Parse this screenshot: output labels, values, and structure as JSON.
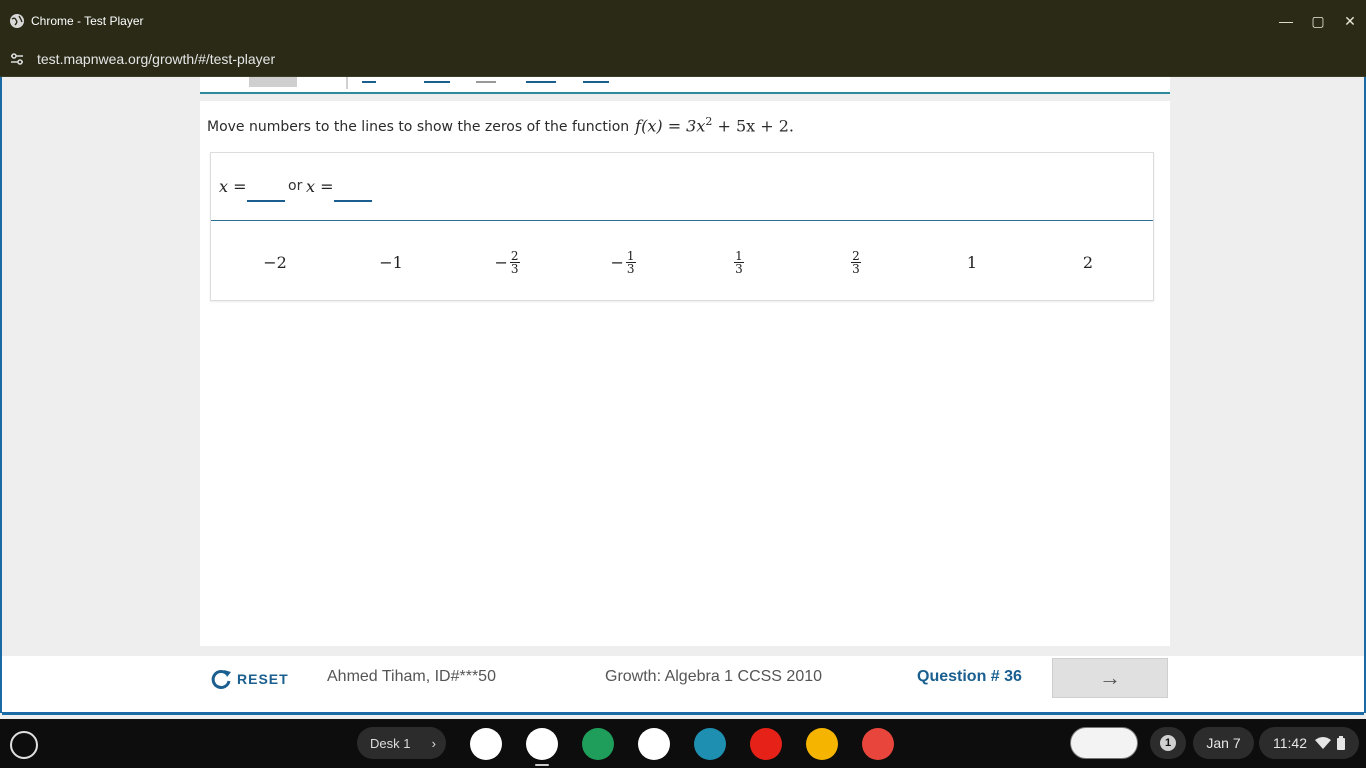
{
  "window": {
    "title": "Chrome - Test Player",
    "url": "test.mapnwea.org/growth/#/test-player"
  },
  "question": {
    "prompt": "Move numbers to the lines to show the zeros of the function",
    "function_lhs": "f(x) = 3x",
    "exponent": "2",
    "function_rhs": " + 5x + 2.",
    "answer_label_1": "x =",
    "or_text": "or",
    "answer_label_2": "x ="
  },
  "tiles": [
    {
      "sign": "",
      "whole": "−2",
      "num": "",
      "den": ""
    },
    {
      "sign": "",
      "whole": "−1",
      "num": "",
      "den": ""
    },
    {
      "sign": "−",
      "whole": "",
      "num": "2",
      "den": "3"
    },
    {
      "sign": "−",
      "whole": "",
      "num": "1",
      "den": "3"
    },
    {
      "sign": "",
      "whole": "",
      "num": "1",
      "den": "3"
    },
    {
      "sign": "",
      "whole": "",
      "num": "2",
      "den": "3"
    },
    {
      "sign": "",
      "whole": "1",
      "num": "",
      "den": ""
    },
    {
      "sign": "",
      "whole": "2",
      "num": "",
      "den": ""
    }
  ],
  "footer": {
    "reset_label": "RESET",
    "student": "Ahmed Tiham, ID#***50",
    "test_name": "Growth: Algebra 1 CCSS 2010",
    "question_number": "Question # 36",
    "next_arrow": "→"
  },
  "shelf": {
    "desk_label": "Desk 1",
    "notification_count": "1",
    "date": "Jan 7",
    "time": "11:42",
    "apps": [
      "maps",
      "chrome",
      "sheets",
      "gmail",
      "classroom",
      "youtube",
      "slides",
      "canvas"
    ]
  },
  "colors": {
    "accent": "#1a5f8f",
    "titlebar": "#2a2a17",
    "page_border": "#1a6aa6"
  }
}
